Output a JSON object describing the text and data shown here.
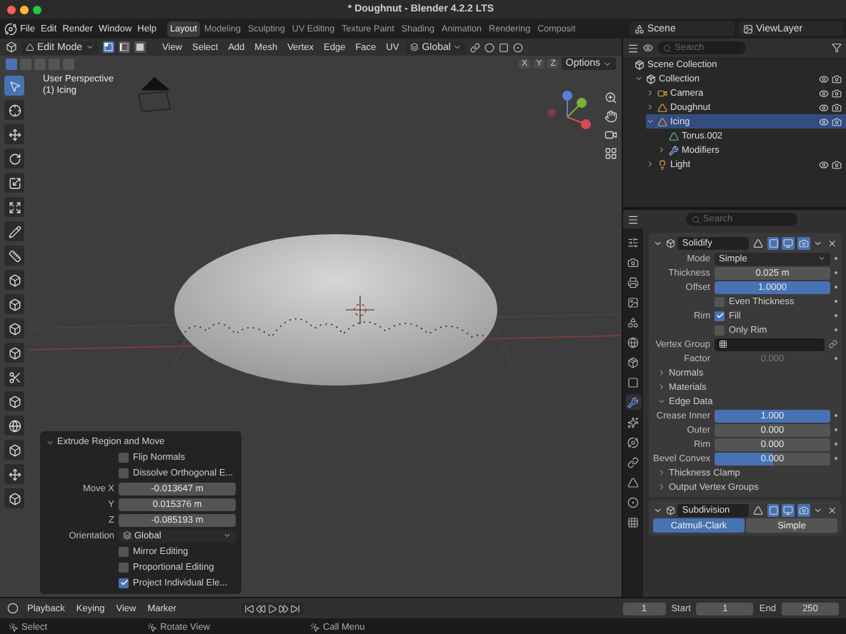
{
  "window": {
    "title": "* Doughnut - Blender 4.2.2 LTS"
  },
  "menu": [
    "File",
    "Edit",
    "Render",
    "Window",
    "Help"
  ],
  "workspaces": [
    {
      "label": "Layout",
      "selected": true
    },
    {
      "label": "Modeling",
      "selected": false
    },
    {
      "label": "Sculpting",
      "selected": false
    },
    {
      "label": "UV Editing",
      "selected": false
    },
    {
      "label": "Texture Paint",
      "selected": false
    },
    {
      "label": "Shading",
      "selected": false
    },
    {
      "label": "Animation",
      "selected": false
    },
    {
      "label": "Rendering",
      "selected": false
    },
    {
      "label": "Composit",
      "selected": false
    }
  ],
  "scene": "Scene",
  "view_layer": "ViewLayer",
  "viewport": {
    "mode": "Edit Mode",
    "menu": [
      "View",
      "Select",
      "Add",
      "Mesh",
      "Vertex",
      "Edge",
      "Face",
      "UV"
    ],
    "orientation": "Global",
    "select_modes": [
      {
        "kind": "vertex",
        "selected": true
      },
      {
        "kind": "edge",
        "selected": false
      },
      {
        "kind": "face",
        "selected": false
      }
    ],
    "axes": [
      "X",
      "Y",
      "Z"
    ],
    "options": "Options",
    "info": [
      "User Perspective",
      "(1) Icing"
    ],
    "tools": [
      {
        "kind": "pointer",
        "selected": true
      },
      {
        "kind": "cursor",
        "selected": false
      },
      {
        "kind": "move",
        "selected": false
      },
      {
        "kind": "rotate",
        "selected": false
      },
      {
        "kind": "scale",
        "selected": false
      },
      {
        "kind": "transform",
        "selected": false
      },
      {
        "kind": "annotate",
        "selected": false
      },
      {
        "kind": "measure",
        "selected": false
      },
      {
        "kind": "cube",
        "selected": false
      },
      {
        "kind": "cube",
        "selected": false
      },
      {
        "kind": "cube",
        "selected": false
      },
      {
        "kind": "cube",
        "selected": false
      },
      {
        "kind": "knife",
        "selected": false
      },
      {
        "kind": "cube",
        "selected": false
      },
      {
        "kind": "sphere",
        "selected": false
      },
      {
        "kind": "cube",
        "selected": false
      },
      {
        "kind": "move",
        "selected": false
      },
      {
        "kind": "cube",
        "selected": false
      }
    ]
  },
  "operator_panel": {
    "title": "Extrude Region and Move",
    "rows": [
      {
        "kind": "check",
        "label": "Flip Normals",
        "checked": false
      },
      {
        "kind": "check",
        "label": "Dissolve Orthogonal E...",
        "checked": false
      },
      {
        "kind": "number",
        "label": "Move X",
        "value": "-0.013647 m"
      },
      {
        "kind": "number",
        "label": "Y",
        "value": "0.015376 m"
      },
      {
        "kind": "number",
        "label": "Z",
        "value": "-0.085193 m"
      },
      {
        "kind": "select",
        "label": "Orientation",
        "value": "Global"
      },
      {
        "kind": "check",
        "label": "Mirror Editing",
        "checked": false
      },
      {
        "kind": "check",
        "label": "Proportional Editing",
        "checked": false
      },
      {
        "kind": "check",
        "label": "Project Individual Ele...",
        "checked": true
      }
    ]
  },
  "outliner": {
    "search": {
      "placeholder": "Search"
    },
    "tree": [
      {
        "kind": "scene_collection",
        "label": "Scene Collection",
        "selected": false,
        "children": [
          {
            "kind": "collection",
            "label": "Collection",
            "selected": false,
            "expanded": true,
            "children": [
              {
                "kind": "camera",
                "label": "Camera",
                "selected": false,
                "expanded": false
              },
              {
                "kind": "mesh",
                "label": "Doughnut",
                "selected": false,
                "expanded": false
              },
              {
                "kind": "mesh",
                "label": "Icing",
                "selected": true,
                "expanded": true,
                "children": [
                  {
                    "kind": "mesh_data",
                    "label": "Torus.002",
                    "selected": false
                  },
                  {
                    "kind": "modifiers",
                    "label": "Modifiers",
                    "selected": false,
                    "expanded": false
                  }
                ]
              },
              {
                "kind": "light",
                "label": "Light",
                "selected": false,
                "expanded": false
              }
            ]
          }
        ]
      }
    ]
  },
  "properties": {
    "search": {
      "placeholder": "Search"
    },
    "tabs": [
      {
        "kind": "tool",
        "selected": false
      },
      {
        "kind": "render",
        "selected": false
      },
      {
        "kind": "output",
        "selected": false
      },
      {
        "kind": "view",
        "selected": false
      },
      {
        "kind": "scene",
        "selected": false
      },
      {
        "kind": "world",
        "selected": false
      },
      {
        "kind": "collection",
        "selected": false
      },
      {
        "kind": "object",
        "selected": false
      },
      {
        "kind": "modifiers",
        "selected": true
      },
      {
        "kind": "particles",
        "selected": false
      },
      {
        "kind": "physics",
        "selected": false
      },
      {
        "kind": "constraints",
        "selected": false
      },
      {
        "kind": "data",
        "selected": false
      },
      {
        "kind": "material",
        "selected": false
      },
      {
        "kind": "texture",
        "selected": false
      }
    ],
    "modifiers": [
      {
        "name": "Solidify",
        "expanded": true,
        "toggles": [
          {
            "kind": "cage",
            "on": false
          },
          {
            "kind": "edit",
            "on": true
          },
          {
            "kind": "viewport",
            "on": true
          },
          {
            "kind": "render",
            "on": true
          }
        ],
        "rows": [
          {
            "kind": "select",
            "label": "Mode",
            "value": "Simple"
          },
          {
            "kind": "number",
            "label": "Thickness",
            "value": "0.025 m",
            "disabled": false
          },
          {
            "kind": "slider",
            "label": "Offset",
            "value": "1.0000",
            "level": 1,
            "disabled": false
          },
          {
            "kind": "check",
            "label": "Even Thickness",
            "checked": false
          },
          {
            "kind": "check",
            "group": "Rim",
            "label": "Fill",
            "checked": true
          },
          {
            "kind": "check",
            "label": "Only Rim",
            "checked": false
          },
          {
            "kind": "field",
            "label": "Vertex Group"
          },
          {
            "kind": "number",
            "label": "Factor",
            "value": "0.000",
            "disabled": true
          },
          {
            "kind": "section",
            "label": "Normals",
            "expanded": false
          },
          {
            "kind": "section",
            "label": "Materials",
            "expanded": false
          },
          {
            "kind": "section",
            "label": "Edge Data",
            "expanded": true
          },
          {
            "kind": "slider",
            "label": "Crease Inner",
            "value": "1.000",
            "level": 1,
            "disabled": false
          },
          {
            "kind": "slider",
            "label": "Outer",
            "value": "0.000",
            "level": 0,
            "disabled": false
          },
          {
            "kind": "slider",
            "label": "Rim",
            "value": "0.000",
            "level": 0,
            "disabled": false
          },
          {
            "kind": "slider",
            "label": "Bevel Convex",
            "value": "0.000",
            "level": 0.5,
            "disabled": false
          },
          {
            "kind": "section",
            "label": "Thickness Clamp",
            "expanded": false
          },
          {
            "kind": "section",
            "label": "Output Vertex Groups",
            "expanded": false
          }
        ]
      },
      {
        "name": "Subdivision",
        "expanded": true,
        "toggles": [
          {
            "kind": "cage",
            "on": false
          },
          {
            "kind": "edit",
            "on": true
          },
          {
            "kind": "viewport",
            "on": true
          },
          {
            "kind": "render",
            "on": true
          }
        ],
        "options": [
          {
            "label": "Catmull-Clark",
            "selected": true
          },
          {
            "label": "Simple",
            "selected": false
          }
        ]
      }
    ]
  },
  "timeline": {
    "menu": [
      "Playback",
      "Keying",
      "View",
      "Marker"
    ],
    "frame": "1",
    "start_label": "Start",
    "start": "1",
    "end_label": "End",
    "end": "250"
  },
  "status_bar": [
    "Select",
    "Rotate View",
    "Call Menu"
  ]
}
